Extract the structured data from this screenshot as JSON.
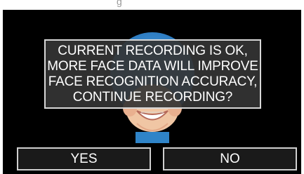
{
  "header": {
    "title_partial": "g"
  },
  "dialog": {
    "message": "CURRENT RECORDING IS OK,\nMORE FACE DATA WILL IMPROVE\nFACE RECOGNITION ACCURACY,\nCONTINUE RECORDING?"
  },
  "buttons": {
    "yes_label": "YES",
    "no_label": "NO"
  },
  "colors": {
    "background": "#000000",
    "dialog_bg": "#343434",
    "accent_blue": "#2f84c8"
  }
}
